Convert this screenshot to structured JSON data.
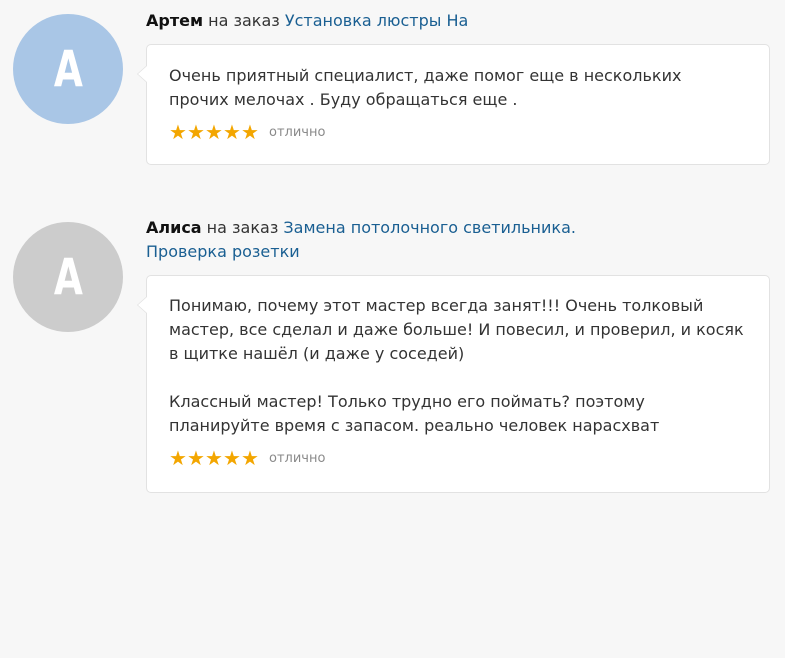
{
  "reviews": [
    {
      "avatar_letter": "А",
      "avatar_color": "#a9c6e6",
      "author": "Артем",
      "connector": " на заказ ",
      "order_line1": "Установка люстры На",
      "order_line2": "",
      "text": "Очень приятный специалист, даже помог еще в нескольких\nпрочих мелочах . Буду обращаться еще .",
      "stars": 5,
      "rating_label": "отлично"
    },
    {
      "avatar_letter": "А",
      "avatar_color": "#cccccc",
      "author": "Алиса",
      "connector": " на заказ ",
      "order_line1": "Замена потолочного светильника.",
      "order_line2": "Проверка розетки",
      "text": "Понимаю, почему этот мастер всегда занят!!! Очень толковый\nмастер, все сделал и даже больше! И повесил, и проверил, и косяк\nв щитке нашёл (и даже у соседей)\n\nКлассный мастер! Только трудно его поймать? поэтому\nпланируйте время с запасом. реально человек нарасхват",
      "stars": 5,
      "rating_label": "отлично"
    }
  ],
  "colors": {
    "star": "#f3a600",
    "link": "#1a5f92",
    "background": "#f7f7f7"
  }
}
